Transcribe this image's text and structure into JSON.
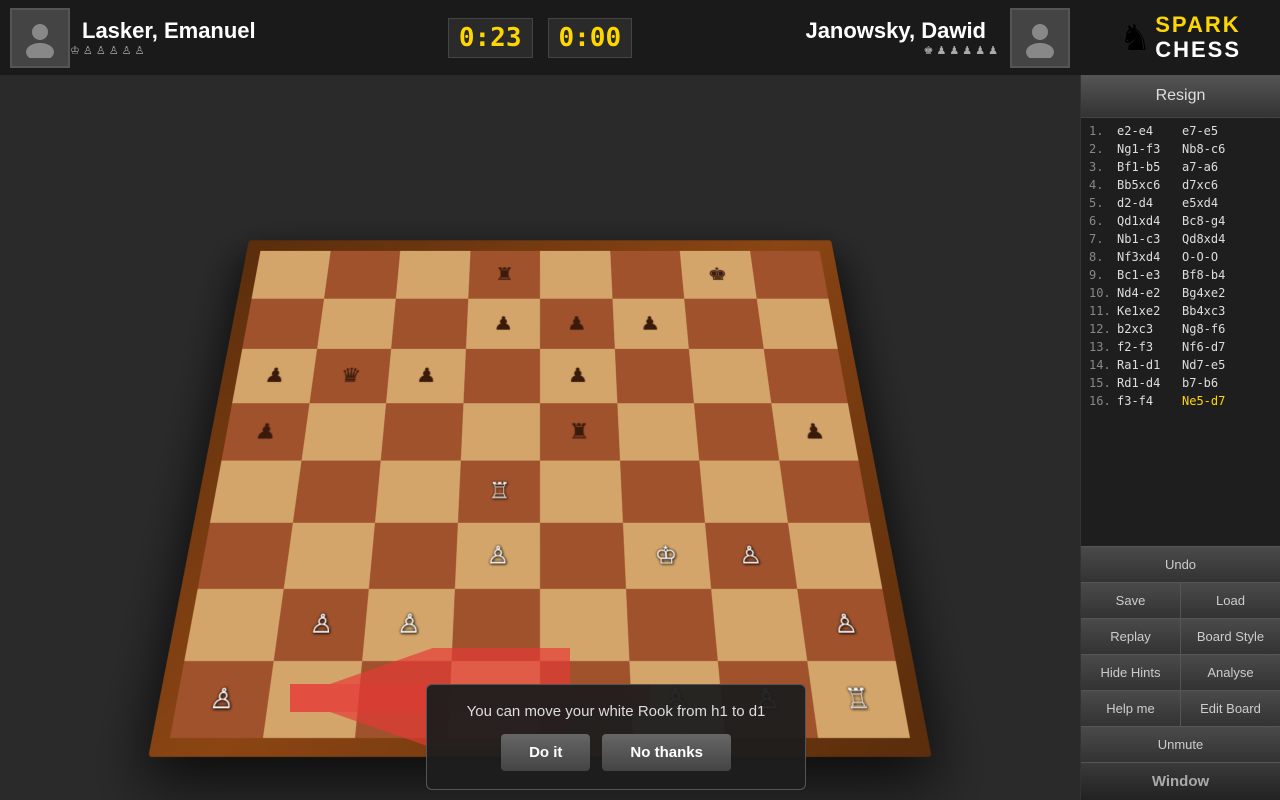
{
  "header": {
    "player_left": {
      "name": "Lasker, Emanuel",
      "pieces": "♔♙♙♙♙♙",
      "timer": "0:23"
    },
    "player_right": {
      "name": "Janowsky, Dawid",
      "pieces": "♚♟♟♟♟♟",
      "timer": "0:00"
    },
    "logo": {
      "spark": "SPARK",
      "chess": "CHESS"
    }
  },
  "moves": [
    {
      "num": "1.",
      "white": "e2-e4",
      "black": "e7-e5",
      "highlight": false
    },
    {
      "num": "2.",
      "white": "Ng1-f3",
      "black": "Nb8-c6",
      "highlight": false
    },
    {
      "num": "3.",
      "white": "Bf1-b5",
      "black": "a7-a6",
      "highlight": false
    },
    {
      "num": "4.",
      "white": "Bb5xc6",
      "black": "d7xc6",
      "highlight": false
    },
    {
      "num": "5.",
      "white": "d2-d4",
      "black": "e5xd4",
      "highlight": false
    },
    {
      "num": "6.",
      "white": "Qd1xd4",
      "black": "Bc8-g4",
      "highlight": false
    },
    {
      "num": "7.",
      "white": "Nb1-c3",
      "black": "Qd8xd4",
      "highlight": false
    },
    {
      "num": "8.",
      "white": "Nf3xd4",
      "black": "O-O-O",
      "highlight": false
    },
    {
      "num": "9.",
      "white": "Bc1-e3",
      "black": "Bf8-b4",
      "highlight": false
    },
    {
      "num": "10.",
      "white": "Nd4-e2",
      "black": "Bg4xe2",
      "highlight": false
    },
    {
      "num": "11.",
      "white": "Ke1xe2",
      "black": "Bb4xc3",
      "highlight": false
    },
    {
      "num": "12.",
      "white": "b2xc3",
      "black": "Ng8-f6",
      "highlight": false
    },
    {
      "num": "13.",
      "white": "f2-f3",
      "black": "Nf6-d7",
      "highlight": false
    },
    {
      "num": "14.",
      "white": "Ra1-d1",
      "black": "Nd7-e5",
      "highlight": false
    },
    {
      "num": "15.",
      "white": "Rd1-d4",
      "black": "b7-b6",
      "highlight": false
    },
    {
      "num": "16.",
      "white": "f3-f4",
      "black": "Ne5-d7",
      "highlight": true
    }
  ],
  "buttons": {
    "resign": "Resign",
    "undo": "Undo",
    "save": "Save",
    "load": "Load",
    "replay": "Replay",
    "board_style": "Board Style",
    "hide_hints": "Hide Hints",
    "analyse": "Analyse",
    "help_me": "Help me",
    "edit_board": "Edit Board",
    "unmute": "Unmute",
    "window": "Window"
  },
  "hint": {
    "message": "You can move your white Rook from h1 to d1",
    "do_it": "Do it",
    "no_thanks": "No thanks"
  }
}
